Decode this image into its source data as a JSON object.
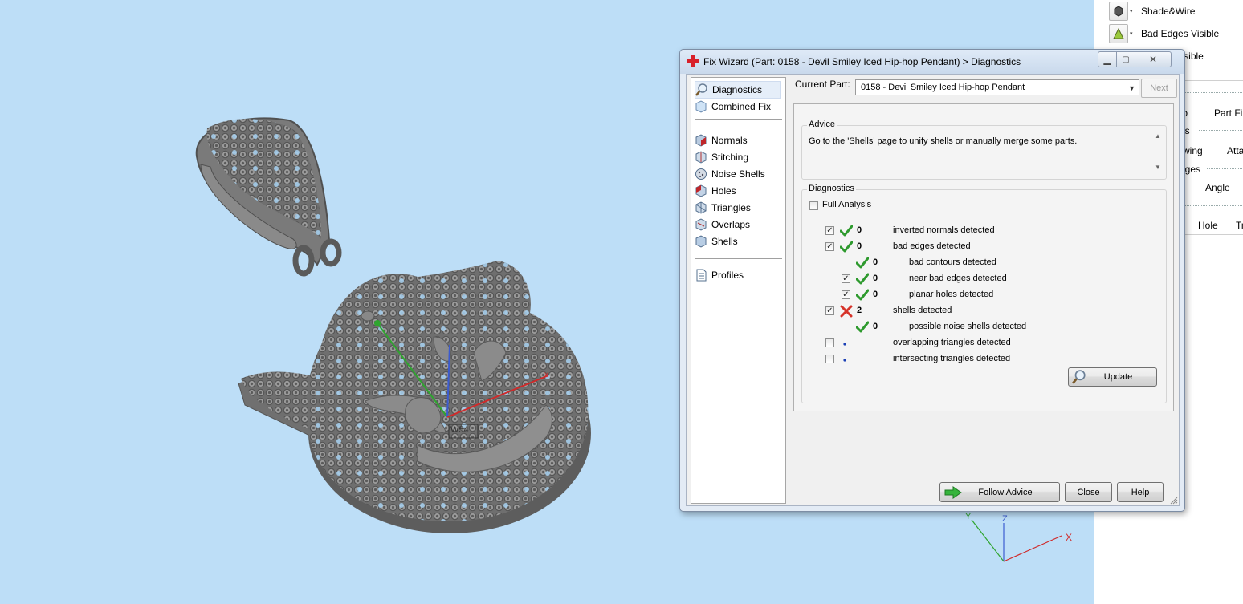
{
  "right_panel": {
    "items": [
      {
        "label": "Shade&Wire",
        "icon": "shade-wire-icon"
      },
      {
        "label": "Bad Edges Visible",
        "icon": "bad-edges-icon"
      },
      {
        "label": "angles Visible",
        "icon": "triangles-icon"
      }
    ],
    "fragments": [
      "fo",
      "Part Fix",
      "es",
      "wing",
      "Atta",
      "ages",
      "Angle",
      "Hole",
      "Tr"
    ]
  },
  "viewport": {
    "axis_label": "W54",
    "mini_axes": {
      "x": "X",
      "y": "Y",
      "z": "Z"
    }
  },
  "dialog": {
    "title": "Fix Wizard (Part: 0158 - Devil Smiley Iced  Hip-hop Pendant) > Diagnostics",
    "nav": [
      {
        "label": "Diagnostics",
        "icon": "diagnostics-magnifier-icon",
        "selected": true
      },
      {
        "label": "Combined Fix",
        "icon": "combined-fix-icon"
      },
      {
        "label": "Normals",
        "icon": "normals-icon"
      },
      {
        "label": "Stitching",
        "icon": "stitching-icon"
      },
      {
        "label": "Noise Shells",
        "icon": "noise-shells-icon"
      },
      {
        "label": "Holes",
        "icon": "holes-icon"
      },
      {
        "label": "Triangles",
        "icon": "triangles-icon"
      },
      {
        "label": "Overlaps",
        "icon": "overlaps-icon"
      },
      {
        "label": "Shells",
        "icon": "shells-icon"
      },
      {
        "label": "Profiles",
        "icon": "profiles-icon"
      }
    ],
    "current_part_label": "Current Part:",
    "current_part_value": "0158 - Devil Smiley Iced  Hip-hop Pendant",
    "next_label": "Next",
    "advice_title": "Advice",
    "advice_text": "Go to the 'Shells' page to unify shells or manually merge some parts.",
    "diagnostics_title": "Diagnostics",
    "full_analysis_label": "Full Analysis",
    "full_analysis_checked": false,
    "rows": [
      {
        "checkbox": true,
        "checked": true,
        "status": "ok",
        "count": "0",
        "label": "inverted normals detected",
        "indent": 0
      },
      {
        "checkbox": true,
        "checked": true,
        "status": "ok",
        "count": "0",
        "label": "bad edges detected",
        "indent": 0
      },
      {
        "checkbox": false,
        "checked": false,
        "status": "ok",
        "count": "0",
        "label": "bad contours detected",
        "indent": 1
      },
      {
        "checkbox": true,
        "checked": true,
        "status": "ok",
        "count": "0",
        "label": "near bad edges detected",
        "indent": 1
      },
      {
        "checkbox": true,
        "checked": true,
        "status": "ok",
        "count": "0",
        "label": "planar holes detected",
        "indent": 1
      },
      {
        "checkbox": true,
        "checked": true,
        "status": "error",
        "count": "2",
        "label": "shells detected",
        "indent": 0
      },
      {
        "checkbox": false,
        "checked": false,
        "status": "ok",
        "count": "0",
        "label": "possible noise shells detected",
        "indent": 1
      },
      {
        "checkbox": true,
        "checked": false,
        "status": "none",
        "count": "",
        "label": "overlapping triangles detected",
        "indent": 0
      },
      {
        "checkbox": true,
        "checked": false,
        "status": "none",
        "count": "",
        "label": "intersecting triangles detected",
        "indent": 0
      }
    ],
    "update_label": "Update",
    "follow_advice_label": "Follow Advice",
    "close_label": "Close",
    "help_label": "Help",
    "colors": {
      "ok": "#2e9a2e",
      "error": "#d6332a",
      "accent": "#1a3fb5"
    }
  }
}
